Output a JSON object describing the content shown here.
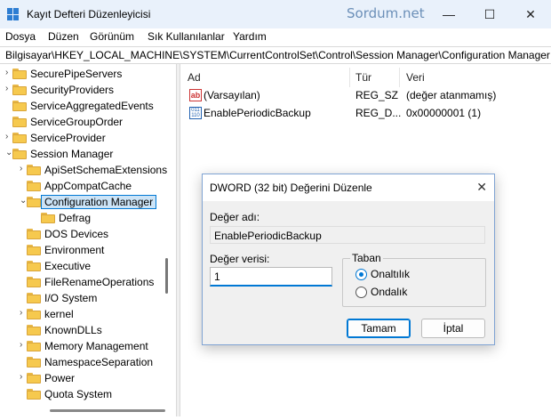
{
  "window": {
    "title": "Kayıt Defteri Düzenleyicisi",
    "watermark": "Sordum.net",
    "minimize_glyph": "—",
    "maximize_glyph": "☐",
    "close_glyph": "✕"
  },
  "menu": {
    "items": [
      "Dosya",
      "Düzen",
      "Görünüm",
      "Sık Kullanılanlar",
      "Yardım"
    ]
  },
  "address": {
    "path": "Bilgisayar\\HKEY_LOCAL_MACHINE\\SYSTEM\\CurrentControlSet\\Control\\Session Manager\\Configuration Manager"
  },
  "tree": {
    "items": [
      {
        "label": "SecurePipeServers",
        "level": 0,
        "chevron": "›"
      },
      {
        "label": "SecurityProviders",
        "level": 0,
        "chevron": "›"
      },
      {
        "label": "ServiceAggregatedEvents",
        "level": 0,
        "chevron": ""
      },
      {
        "label": "ServiceGroupOrder",
        "level": 0,
        "chevron": ""
      },
      {
        "label": "ServiceProvider",
        "level": 0,
        "chevron": "›"
      },
      {
        "label": "Session Manager",
        "level": 0,
        "chevron": "⌄"
      },
      {
        "label": "ApiSetSchemaExtensions",
        "level": 1,
        "chevron": "›"
      },
      {
        "label": "AppCompatCache",
        "level": 1,
        "chevron": ""
      },
      {
        "label": "Configuration Manager",
        "level": 1,
        "chevron": "⌄",
        "selected": true
      },
      {
        "label": "Defrag",
        "level": 2,
        "chevron": ""
      },
      {
        "label": "DOS Devices",
        "level": 1,
        "chevron": ""
      },
      {
        "label": "Environment",
        "level": 1,
        "chevron": ""
      },
      {
        "label": "Executive",
        "level": 1,
        "chevron": ""
      },
      {
        "label": "FileRenameOperations",
        "level": 1,
        "chevron": ""
      },
      {
        "label": "I/O System",
        "level": 1,
        "chevron": ""
      },
      {
        "label": "kernel",
        "level": 1,
        "chevron": "›"
      },
      {
        "label": "KnownDLLs",
        "level": 1,
        "chevron": ""
      },
      {
        "label": "Memory Management",
        "level": 1,
        "chevron": "›"
      },
      {
        "label": "NamespaceSeparation",
        "level": 1,
        "chevron": ""
      },
      {
        "label": "Power",
        "level": 1,
        "chevron": "›"
      },
      {
        "label": "Quota System",
        "level": 1,
        "chevron": ""
      }
    ]
  },
  "list": {
    "columns": [
      "Ad",
      "Tür",
      "Veri"
    ],
    "rows": [
      {
        "icon": "string-value-icon",
        "icon_text": "ab",
        "name": "(Varsayılan)",
        "type": "REG_SZ",
        "data": "(değer atanmamış)"
      },
      {
        "icon": "binary-value-icon",
        "icon_text": "011 110",
        "name": "EnablePeriodicBackup",
        "type": "REG_D...",
        "data": "0x00000001 (1)"
      }
    ]
  },
  "dialog": {
    "title": "DWORD (32 bit) Değerini Düzenle",
    "close_glyph": "✕",
    "name_label": "Değer adı:",
    "name_value": "EnablePeriodicBackup",
    "data_label": "Değer verisi:",
    "data_value": "1",
    "base_label": "Taban",
    "radio_hex": "Onaltılık",
    "radio_dec": "Ondalık",
    "ok_label": "Tamam",
    "cancel_label": "İptal"
  }
}
